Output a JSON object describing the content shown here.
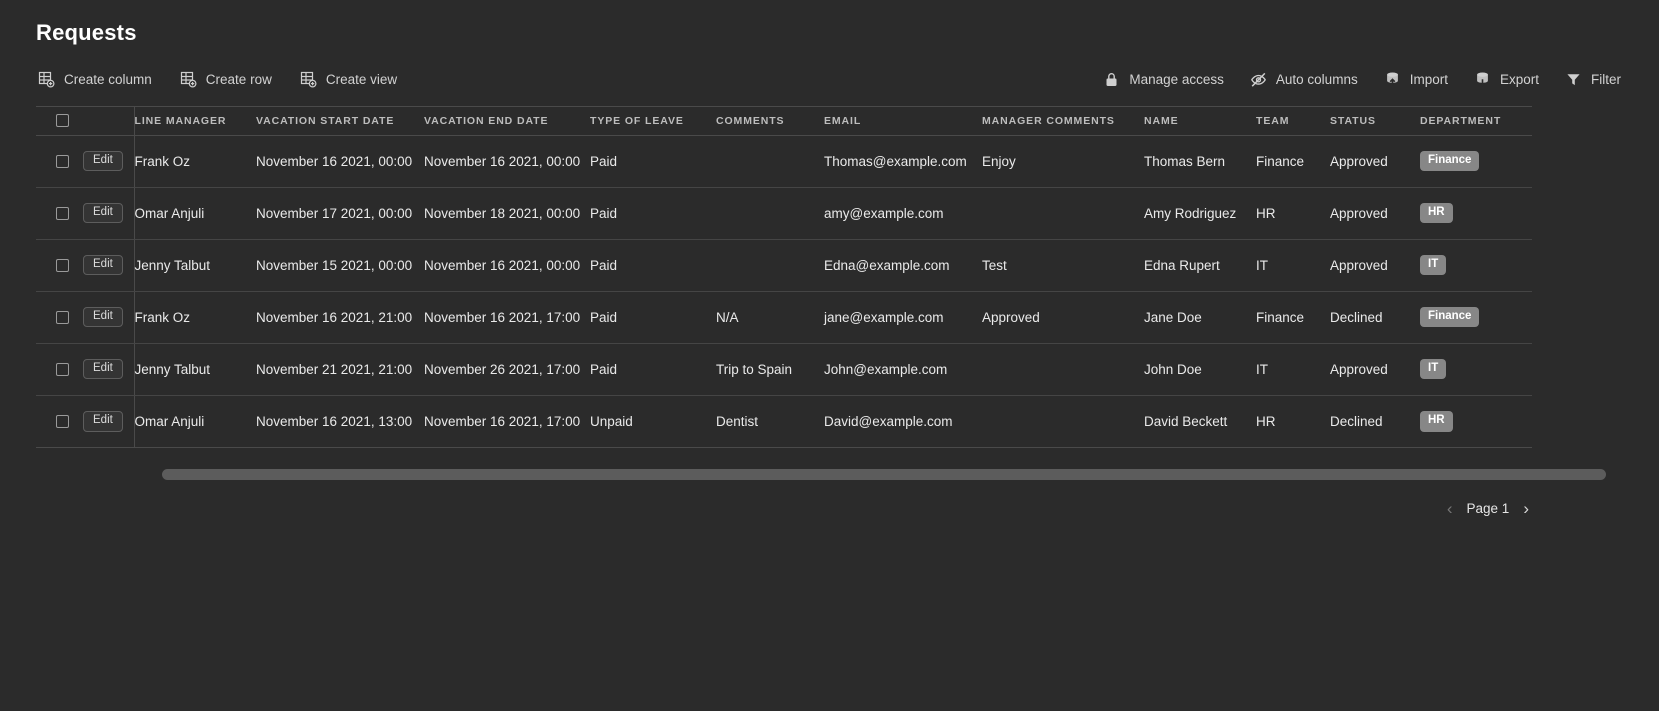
{
  "header": {
    "title": "Requests"
  },
  "toolbar": {
    "left": [
      {
        "label": "Create column",
        "icon": "create-column-icon"
      },
      {
        "label": "Create row",
        "icon": "create-row-icon"
      },
      {
        "label": "Create view",
        "icon": "create-view-icon"
      }
    ],
    "right": [
      {
        "label": "Manage access",
        "icon": "lock-icon"
      },
      {
        "label": "Auto columns",
        "icon": "eye-off-icon"
      },
      {
        "label": "Import",
        "icon": "import-icon"
      },
      {
        "label": "Export",
        "icon": "export-icon"
      },
      {
        "label": "Filter",
        "icon": "filter-icon"
      }
    ]
  },
  "table": {
    "row_action_label": "Edit",
    "columns": [
      "LINE MANAGER",
      "VACATION START DATE",
      "VACATION END DATE",
      "TYPE OF LEAVE",
      "COMMENTS",
      "EMAIL",
      "MANAGER COMMENTS",
      "NAME",
      "TEAM",
      "STATUS",
      "DEPARTMENT"
    ],
    "rows": [
      {
        "line_manager": "Frank Oz",
        "vacation_start_date": "November 16 2021, 00:00",
        "vacation_end_date": "November 16 2021, 00:00",
        "type_of_leave": "Paid",
        "comments": "",
        "email": "Thomas@example.com",
        "manager_comments": "Enjoy",
        "name": "Thomas Bern",
        "team": "Finance",
        "status": "Approved",
        "department": "Finance"
      },
      {
        "line_manager": "Omar Anjuli",
        "vacation_start_date": "November 17 2021, 00:00",
        "vacation_end_date": "November 18 2021, 00:00",
        "type_of_leave": "Paid",
        "comments": "",
        "email": "amy@example.com",
        "manager_comments": "",
        "name": "Amy Rodriguez",
        "team": "HR",
        "status": "Approved",
        "department": "HR"
      },
      {
        "line_manager": "Jenny Talbut",
        "vacation_start_date": "November 15 2021, 00:00",
        "vacation_end_date": "November 16 2021, 00:00",
        "type_of_leave": "Paid",
        "comments": "",
        "email": "Edna@example.com",
        "manager_comments": "Test",
        "name": "Edna Rupert",
        "team": "IT",
        "status": "Approved",
        "department": "IT"
      },
      {
        "line_manager": "Frank Oz",
        "vacation_start_date": "November 16 2021, 21:00",
        "vacation_end_date": "November 16 2021, 17:00",
        "type_of_leave": "Paid",
        "comments": "N/A",
        "email": "jane@example.com",
        "manager_comments": "Approved",
        "name": "Jane Doe",
        "team": "Finance",
        "status": "Declined",
        "department": "Finance"
      },
      {
        "line_manager": "Jenny Talbut",
        "vacation_start_date": "November 21 2021, 21:00",
        "vacation_end_date": "November 26 2021, 17:00",
        "type_of_leave": "Paid",
        "comments": "Trip to Spain",
        "email": "John@example.com",
        "manager_comments": "",
        "name": "John Doe",
        "team": "IT",
        "status": "Approved",
        "department": "IT"
      },
      {
        "line_manager": "Omar Anjuli",
        "vacation_start_date": "November 16 2021, 13:00",
        "vacation_end_date": "November 16 2021, 17:00",
        "type_of_leave": "Unpaid",
        "comments": "Dentist",
        "email": "David@example.com",
        "manager_comments": "",
        "name": "David Beckett",
        "team": "HR",
        "status": "Declined",
        "department": "HR"
      }
    ]
  },
  "pagination": {
    "prev_icon": "chevron-left-icon",
    "next_icon": "chevron-right-icon",
    "label": "Page 1"
  },
  "colors": {
    "background": "#2b2b2b",
    "badge": "#878787",
    "border": "#4a4a4a",
    "text": "#eaeaea"
  }
}
